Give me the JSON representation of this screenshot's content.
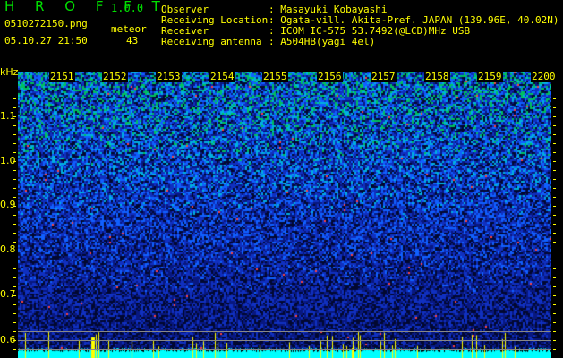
{
  "header": {
    "app_title": "H R O F F T",
    "version": "1.0.0",
    "filename": "0510272150.png",
    "datetime": "05.10.27 21:50",
    "meteor_label": "meteor",
    "meteor_count": "43"
  },
  "info": [
    {
      "label": "Observer",
      "value": ": Masayuki Kobayashi"
    },
    {
      "label": "Receiving Location",
      "value": ": Ogata-vill. Akita-Pref. JAPAN (139.96E, 40.02N)"
    },
    {
      "label": "Receiver",
      "value": ": ICOM IC-575 53.7492(@LCD)MHz USB"
    },
    {
      "label": "Receiving antenna",
      "value": ": A504HB(yagi 4el)"
    }
  ],
  "axis": {
    "y_unit": "kHz",
    "y_labels": [
      "1.1",
      "1.0",
      "0.9",
      "0.8",
      "0.7",
      "0.6"
    ],
    "time_labels": [
      "2151",
      "2152",
      "2153",
      "2154",
      "2155",
      "2156",
      "2157",
      "2158",
      "2159",
      "2200"
    ]
  },
  "colors": {
    "text": "#ffff00",
    "title": "#00e000",
    "baseline": "#00ffff"
  }
}
